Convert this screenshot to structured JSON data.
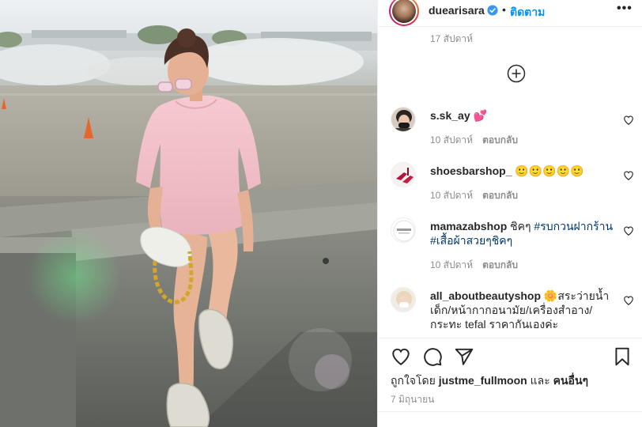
{
  "header": {
    "username": "duearisara",
    "separator": "•",
    "follow_label": "ติดตาม",
    "more_label": "•••"
  },
  "comments_area": {
    "cut_text": "17 สัปดาห์",
    "load_more_icon": "plus-circle-icon"
  },
  "comments": [
    {
      "username": "s.sk_ay",
      "text": "💕",
      "time": "10 สัปดาห์",
      "reply": "ตอบกลับ"
    },
    {
      "username": "shoesbarshop_",
      "text": "🙂🙂🙂🙂🙂",
      "time": "10 สัปดาห์",
      "reply": "ตอบกลับ"
    },
    {
      "username": "mamazabshop",
      "text_plain": "ชิคๆ",
      "hashtag_1": "#รบกวนฝากร้าน",
      "hashtag_2": "#เสื้อผ้าสวยๆชิคๆ",
      "time": "10 สัปดาห์",
      "reply": "ตอบกลับ"
    },
    {
      "username": "all_aboutbeautyshop",
      "text": "🌼สระว่ายน้ำเด็ก/หน้ากากอนามัย/เครื่องสำอาง/กระทะ tefal ราคากันเองค่ะ"
    }
  ],
  "actions": {
    "liked_prefix": "ถูกใจโดย",
    "liked_user": "justme_fullmoon",
    "liked_and": "และ",
    "liked_others": "คนอื่นๆ",
    "date": "7 มิถุนายน"
  },
  "colors": {
    "link_blue": "#0095f6",
    "hashtag": "#00376b",
    "muted": "#8e8e8e",
    "text": "#262626"
  }
}
